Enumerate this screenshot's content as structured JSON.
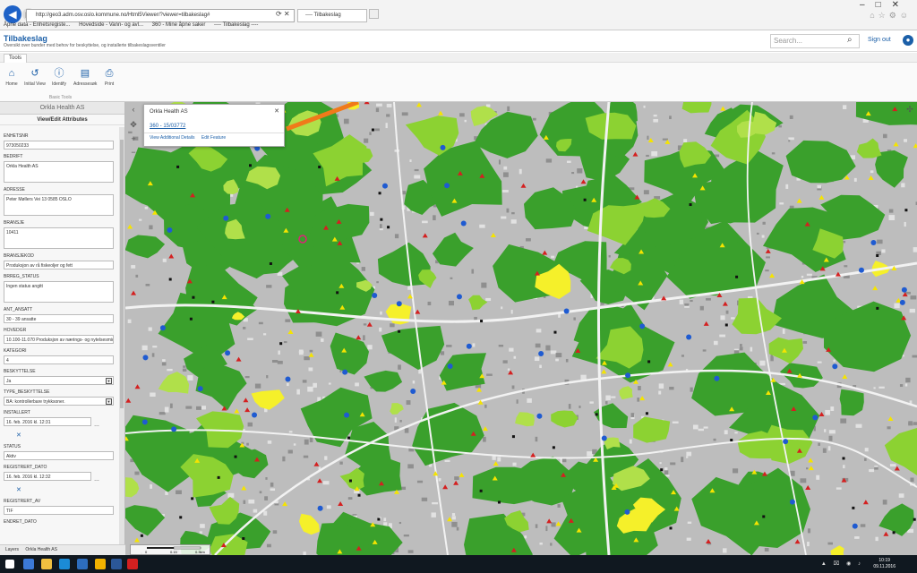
{
  "browser": {
    "url": "http://geo3.adm.osv.oslo.kommune.no/Html5Viewer/?viewer=tilbakeslag#",
    "tab_title": "---- Tilbakeslag",
    "favorites": [
      "Åpne data - Enhetsregiste...",
      "Hovedside - Vann- og avl...",
      "360 - Mine åpne saker",
      "---- Tilbakeslag ----"
    ]
  },
  "app": {
    "title": "Tilbakeslag",
    "subtitle": "Oversikt over bunder med behov for beskyttelse, og installerte tilbakeslagsventiler",
    "search_placeholder": "Search...",
    "sign_out": "Sign out"
  },
  "toolbar": {
    "tab": "Tools",
    "tools": [
      "Home",
      "Initial View",
      "Identify",
      "Adressesøk",
      "Print"
    ],
    "group_label": "Basic Tools"
  },
  "panel": {
    "title": "Orkla Health AS",
    "subtitle": "View/Edit Attributes",
    "fields": [
      {
        "label": "ENHETSNR",
        "value": "973050233",
        "kind": "short"
      },
      {
        "label": "BEDRIFT",
        "value": "Orkla Health AS",
        "kind": "tall"
      },
      {
        "label": "ADRESSE",
        "value": "Peter Møllers Vei 13 0585 OSLO",
        "kind": "tall"
      },
      {
        "label": "BRANSJE",
        "value": "10411",
        "kind": "tall"
      },
      {
        "label": "BRANSJEKOD",
        "value": "Produksjon av rå fiskeoljer og fett",
        "kind": "short"
      },
      {
        "label": "BRREG_STATUS",
        "value": "Ingen status angitt",
        "kind": "tall"
      },
      {
        "label": "ANT_ANSATT",
        "value": "30 - 39 ansatte",
        "kind": "short"
      },
      {
        "label": "HOVEDGR",
        "value": "10.100-11.070 Produksjon av nærings- og nytelsesmidler",
        "kind": "short"
      },
      {
        "label": "KATEGORI",
        "value": "4",
        "kind": "short"
      },
      {
        "label": "BESKYTTELSE",
        "value": "Ja",
        "kind": "select"
      },
      {
        "label": "TYPE_BESKYTTELSE",
        "value": "BA: kontrollerbare trykksoner.",
        "kind": "select"
      },
      {
        "label": "INSTALLERT",
        "value": "16. feb. 2016 kl. 12:31",
        "kind": "date"
      },
      {
        "label": "STATUS",
        "value": "Aktiv",
        "kind": "short"
      },
      {
        "label": "REGISTRERT_DATO",
        "value": "16. feb. 2016 kl. 12:32",
        "kind": "date"
      },
      {
        "label": "REGISTRERT_AV",
        "value": "TIF",
        "kind": "short"
      },
      {
        "label": "ENDRET_DATO",
        "value": "",
        "kind": "label"
      }
    ],
    "footer_layers": "Layers",
    "footer_item": "Orkla Health AS"
  },
  "popup": {
    "title": "Orkla Health AS",
    "link": "360 - 15/03772",
    "view_details": "View Additional Details",
    "edit_feature": "Edit Feature"
  },
  "map": {
    "scale_labels": [
      "0",
      "0.15",
      "0.3km"
    ],
    "colors": {
      "green": "#3aa02c",
      "light_green": "#8cd232",
      "lime": "#b0e04a",
      "yellow": "#f5f02a",
      "grey": "#bdbdbd",
      "red_marker": "#d42020",
      "blue_marker": "#1f5bd1",
      "yellow_marker": "#f5e400"
    }
  },
  "taskbar": {
    "time": "10:19",
    "date": "09.11.2016"
  }
}
